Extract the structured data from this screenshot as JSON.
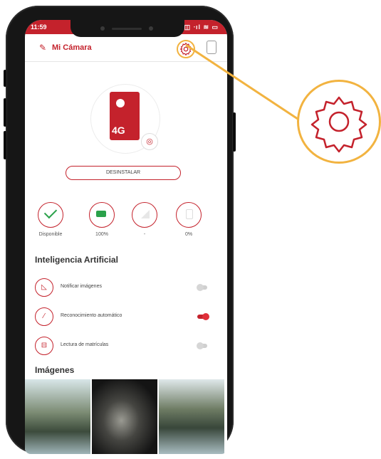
{
  "statusbar": {
    "time": "11:59",
    "icons": "◫ ◫ ᐧıl ≋ ▭"
  },
  "appbar": {
    "title": "Mi Cámara"
  },
  "camera": {
    "label": "4G"
  },
  "uninstall_button": "DESINSTALAR",
  "stats": [
    {
      "icon": "check-icon",
      "value": "Disponible"
    },
    {
      "icon": "battery-icon",
      "value": "100%"
    },
    {
      "icon": "signal-icon",
      "value": "-"
    },
    {
      "icon": "sd-card-icon",
      "value": "0%"
    }
  ],
  "ai": {
    "title": "Inteligencia Artificial",
    "features": [
      {
        "icon": "image-icon",
        "label": "Notificar imágenes",
        "enabled": false
      },
      {
        "icon": "magic-wand-icon",
        "label": "Reconocimiento automático",
        "enabled": true
      },
      {
        "icon": "car-icon",
        "label": "Lectura de matrículas",
        "enabled": false
      }
    ]
  },
  "images": {
    "title": "Imágenes"
  },
  "colors": {
    "accent": "#c4222c",
    "highlight": "#f2b340",
    "success": "#2aa14a"
  }
}
